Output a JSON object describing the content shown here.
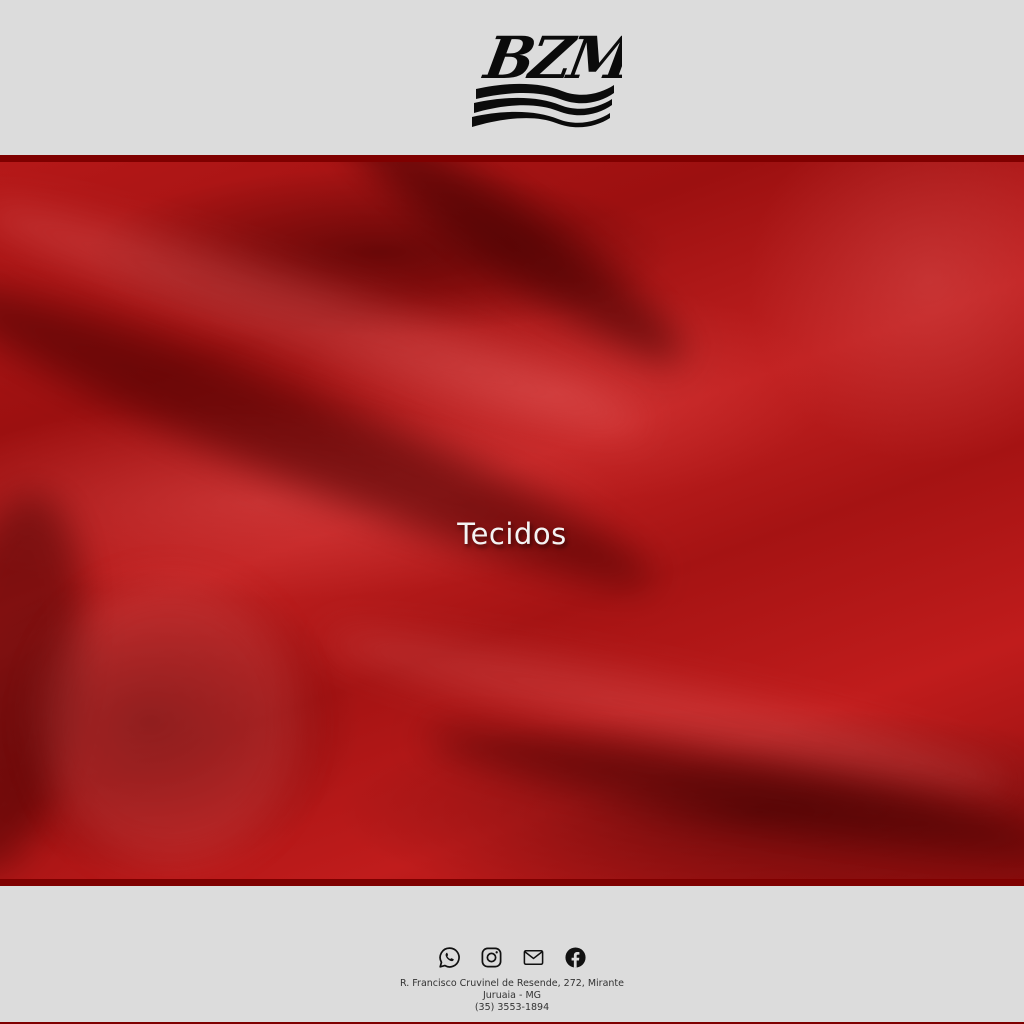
{
  "header": {
    "logo_text": "BZM"
  },
  "hero": {
    "title": "Tecidos"
  },
  "footer": {
    "socials": [
      {
        "icon": "whatsapp-icon"
      },
      {
        "icon": "instagram-icon"
      },
      {
        "icon": "mail-icon"
      },
      {
        "icon": "facebook-icon"
      }
    ],
    "address_line1": "R. Francisco Cruvinel de Resende, 272, Mirante",
    "address_line2": "Juruaia - MG",
    "phone": "(35) 3553-1894"
  },
  "colors": {
    "background": "#dcdcdc",
    "brand_red": "#b51818",
    "border_dark_red": "#7f0000",
    "hero_text": "#f4f4f4"
  }
}
